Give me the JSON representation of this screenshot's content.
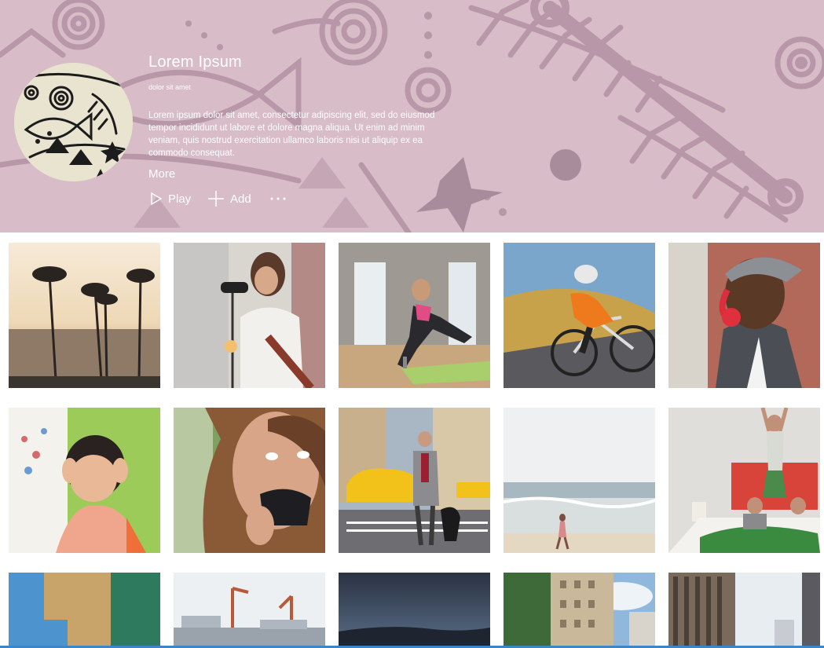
{
  "album": {
    "title": "Lorem Ipsum",
    "subtitle": "dolor sit amet",
    "description": "Lorem ipsum dolor sit amet, consectetur adipiscing elit, sed do eiusmod tempor incididunt ut labore et dolore magna aliqua. Ut enim ad minim veniam, quis nostrud exercitation ullamco laboris nisi ut aliquip ex ea commodo consequat.",
    "more_label": "More"
  },
  "commands": {
    "play_label": "Play",
    "add_label": "Add",
    "more_icon": "ellipsis-icon"
  },
  "colors": {
    "hero_background": "#d8bcc8",
    "hero_pattern": "#a88c9c",
    "accent": "#3a86c8"
  },
  "tiles": [
    {
      "scene": "palm-beach-sunset"
    },
    {
      "scene": "singer-with-guitar"
    },
    {
      "scene": "yoga-stretch"
    },
    {
      "scene": "road-cyclist"
    },
    {
      "scene": "man-with-headphones"
    },
    {
      "scene": "smiling-child"
    },
    {
      "scene": "woman-laughing"
    },
    {
      "scene": "city-street-taxi"
    },
    {
      "scene": "beach-walker"
    },
    {
      "scene": "kid-jumping-on-bed"
    },
    {
      "scene": "color-blocks"
    },
    {
      "scene": "harbor-cranes"
    },
    {
      "scene": "dusk-sky"
    },
    {
      "scene": "city-buildings"
    },
    {
      "scene": "skyscrapers"
    }
  ]
}
